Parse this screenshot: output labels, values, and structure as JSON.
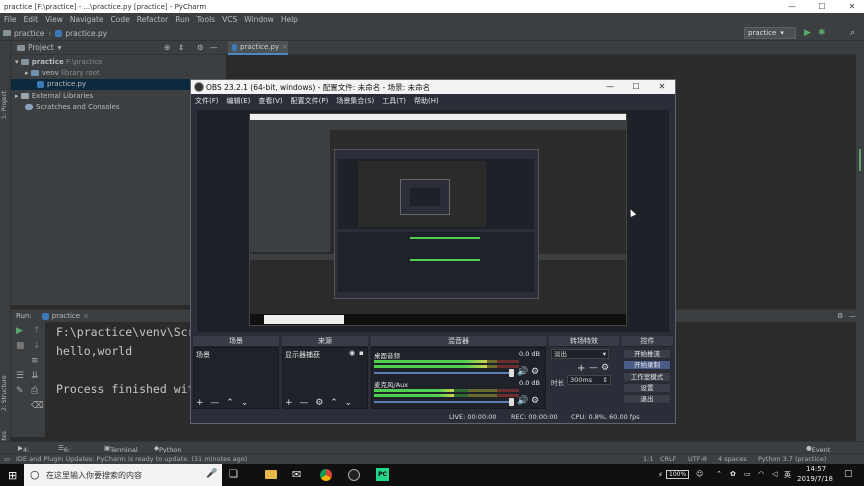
{
  "window": {
    "title": "practice [F:\\practice] - ...\\practice.py [practice] - PyCharm",
    "minimize": "—",
    "maximize": "☐",
    "close": "✕"
  },
  "menu": [
    "File",
    "Edit",
    "View",
    "Navigate",
    "Code",
    "Refactor",
    "Run",
    "Tools",
    "VCS",
    "Window",
    "Help"
  ],
  "nav": {
    "project": "practice",
    "file": "practice.py"
  },
  "toolbar": {
    "run_config": "practice",
    "run_icon": "play-icon",
    "debug_icon": "bug-icon",
    "search_icon": "search-icon"
  },
  "side_tabs": {
    "project": "1: Project",
    "structure": "2: Structure",
    "favorites": "2: Favorites"
  },
  "project_panel": {
    "title": "Project",
    "tree": [
      {
        "label": "practice",
        "hint": "F:\\practice",
        "type": "folder"
      },
      {
        "label": "venv",
        "hint": "library root",
        "type": "folder"
      },
      {
        "label": "practice.py",
        "hint": "",
        "type": "file"
      },
      {
        "label": "External Libraries",
        "hint": "",
        "type": "lib"
      },
      {
        "label": "Scratches and Consoles",
        "hint": "",
        "type": "scratch"
      }
    ]
  },
  "editor": {
    "tab": "practice.py"
  },
  "run_panel": {
    "label": "Run:",
    "tab": "practice",
    "console": [
      "F:\\practice\\venv\\Scrip",
      "hello,world",
      "",
      "Process finished with"
    ]
  },
  "tool_tabs": {
    "run": "4: Run",
    "todo": "6: TODO",
    "terminal": "Terminal",
    "python_console": "Python Console",
    "event_log": "Event Log"
  },
  "status": {
    "message": "IDE and Plugin Updates: PyCharm is ready to update. (31 minutes ago)",
    "position": "1:1",
    "line_sep": "CRLF",
    "encoding": "UTF-8",
    "indent": "4 spaces",
    "interpreter": "Python 3.7 (practice)"
  },
  "obs": {
    "title": "OBS 23.2.1 (64-bit, windows) - 配置文件: 未命名 - 场景: 未命名",
    "menu": [
      "文件(F)",
      "编辑(E)",
      "查看(V)",
      "配置文件(P)",
      "场景集合(S)",
      "工具(T)",
      "帮助(H)"
    ],
    "docks": {
      "scenes": {
        "title": "场景",
        "items": [
          "场景"
        ]
      },
      "sources": {
        "title": "来源",
        "items": [
          "显示器捕获"
        ]
      },
      "mixer": {
        "title": "混音器",
        "channels": [
          {
            "name": "桌面音频",
            "db": "0.0 dB",
            "level": 0.78
          },
          {
            "name": "麦克风/Aux",
            "db": "0.0 dB",
            "level": 0.55
          }
        ]
      },
      "transitions": {
        "title": "转场特效",
        "type": "淡出",
        "duration_label": "时长",
        "duration": "300ms"
      },
      "controls": {
        "title": "控件",
        "buttons": [
          "开始推流",
          "开始录制",
          "工作室模式",
          "设置",
          "退出"
        ]
      }
    },
    "status": {
      "live": "LIVE: 00:00:00",
      "rec": "REC: 00:00:00",
      "cpu": "CPU: 0.8%, 60.00 fps"
    }
  },
  "taskbar": {
    "search_placeholder": "在这里输入你要搜索的内容",
    "time": "14:57",
    "date": "2019/7/18",
    "battery": "100%",
    "ime": "英"
  }
}
